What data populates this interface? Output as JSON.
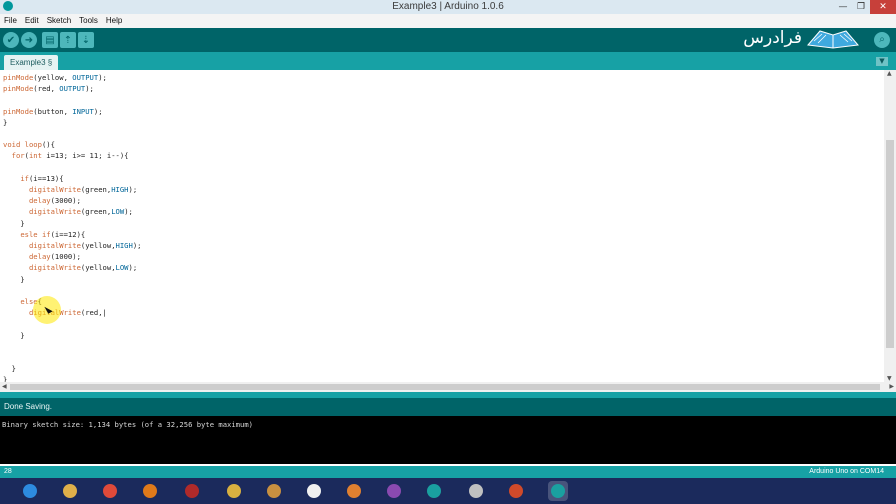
{
  "window": {
    "title": "Example3 | Arduino 1.0.6",
    "controls": [
      "—",
      "❐",
      "✕"
    ]
  },
  "menu": {
    "items": [
      "File",
      "Edit",
      "Sketch",
      "Tools",
      "Help"
    ]
  },
  "toolbar": {
    "buttons": [
      {
        "name": "verify-icon",
        "glyph": "✔"
      },
      {
        "name": "upload-icon",
        "glyph": "➜"
      },
      {
        "name": "new-icon",
        "glyph": "▤"
      },
      {
        "name": "open-icon",
        "glyph": "⇡"
      },
      {
        "name": "save-icon",
        "glyph": "⇣"
      }
    ],
    "serial_glyph": "⌕",
    "logo_text": "فرادرس"
  },
  "tab": {
    "label": "Example3 §",
    "menu_glyph": "▼"
  },
  "editor": {
    "lines": [
      "pinMode(yellow, OUTPUT);",
      "pinMode(red, OUTPUT);",
      "",
      "pinMode(button, INPUT);",
      "}",
      "",
      "void loop(){",
      "  for(int i=13; i>= 11; i--){",
      "",
      "    if(i==13){",
      "      digitalWrite(green,HIGH);",
      "      delay(3000);",
      "      digitalWrite(green,LOW);",
      "    }",
      "    esle if(i==12){",
      "      digitalWrite(yellow,HIGH);",
      "      delay(1000);",
      "      digitalWrite(yellow,LOW);",
      "    }",
      "",
      "    else{",
      "      digitalWrite(red,|",
      "",
      "    }",
      "",
      "",
      "  }",
      "}"
    ]
  },
  "status": {
    "message": "Done Saving."
  },
  "console": {
    "output": "Binary sketch size: 1,134 bytes (of a 32,256 byte maximum)"
  },
  "footer": {
    "line_number": "28",
    "board": "Arduino Uno on COM14"
  },
  "colors": {
    "toolbar": "#006468",
    "accent": "#17a1a5",
    "keyword": "#cc6633",
    "constant": "#006699"
  },
  "taskbar": {
    "apps": [
      "ie-icon",
      "explorer-icon",
      "chrome-icon",
      "app-n-icon",
      "spider-icon",
      "folder-icon",
      "package-icon",
      "app-icon",
      "cat-icon",
      "media-icon",
      "arduino-icon",
      "tool-icon",
      "powerpoint-icon",
      "arduino-active-icon"
    ]
  }
}
